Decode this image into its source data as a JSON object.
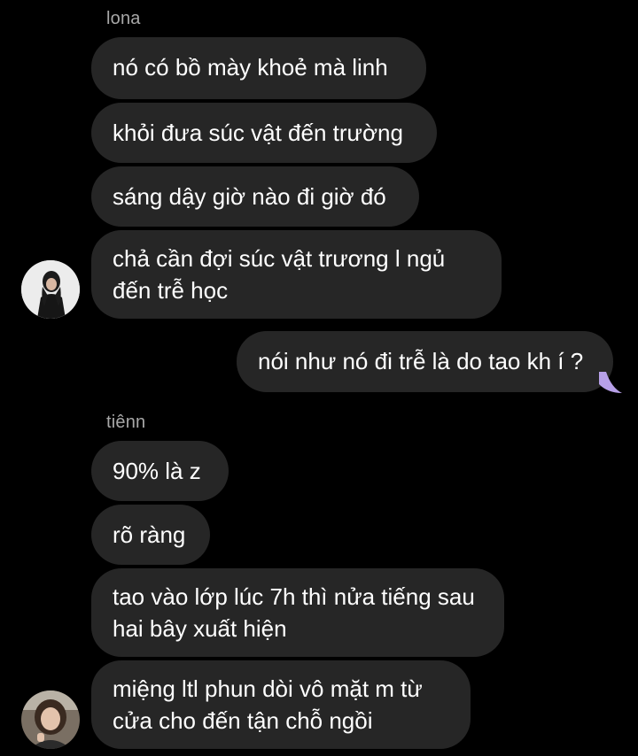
{
  "colors": {
    "background": "#000000",
    "incoming_bubble": "#262626",
    "outgoing_bubble": "#b7a0e8",
    "sender_name": "#a8a8a8"
  },
  "conversation": {
    "groups": [
      {
        "sender": "lona",
        "avatar_icon": "profile-photo-icon",
        "messages": [
          "nó có bồ mày khoẻ mà linh",
          "khỏi đưa súc vật đến trường",
          "sáng dậy giờ nào đi giờ đó",
          "chả cần đợi súc vật trương l ngủ đến trễ học"
        ]
      },
      {
        "sender": "me",
        "messages": [
          "nói như nó đi trễ là do tao kh í ?"
        ]
      },
      {
        "sender": "tiênn",
        "avatar_icon": "profile-photo-icon",
        "messages": [
          "90% là z",
          "rõ ràng",
          "tao vào lớp lúc 7h thì nửa tiếng sau hai bây xuất hiện",
          "miệng ltl phun dòi vô mặt m từ cửa cho đến tận chỗ ngồi"
        ]
      }
    ]
  }
}
